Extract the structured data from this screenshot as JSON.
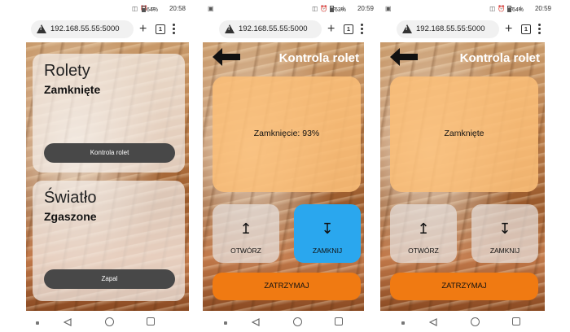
{
  "phone1": {
    "status_bar": {
      "left_icon": "",
      "icons": "◫ ⏰ ᯤ",
      "battery": "64%",
      "time": "20:58"
    },
    "url": "192.168.55.55:5000",
    "tabs_count": "1",
    "cards": [
      {
        "title": "Rolety",
        "status": "Zamknięte",
        "button": "Kontrola rolet"
      },
      {
        "title": "Światło",
        "status": "Zgaszone",
        "button": "Zapal"
      }
    ]
  },
  "phone2": {
    "status_bar": {
      "left_icon": "▣",
      "icons": "◫ ⏰ ᯤ .ıl",
      "battery": "63%",
      "time": "20:59"
    },
    "url": "192.168.55.55:5000",
    "tabs_count": "1",
    "title": "Kontrola rolet",
    "status": "Zamknięcie: 93%",
    "open_label": "OTWÓRZ",
    "close_label": "ZAMKNIJ",
    "stop_label": "ZATRZYMAJ",
    "active_button": "close"
  },
  "phone3": {
    "status_bar": {
      "left_icon": "▣",
      "icons": "◫ ⏰ ᯤ .ıl",
      "battery": "64%",
      "time": "20:59"
    },
    "url": "192.168.55.55:5000",
    "tabs_count": "1",
    "title": "Kontrola rolet",
    "status": "Zamknięte",
    "open_label": "OTWÓRZ",
    "close_label": "ZAMKNIJ",
    "stop_label": "ZATRZYMAJ",
    "active_button": "none"
  },
  "icons": {
    "open": "↥",
    "close": "↧"
  },
  "colors": {
    "active_blue": "#2aa7ee",
    "stop_orange": "#f07a12",
    "status_panel": "#fabe78",
    "card_button": "#484848"
  }
}
